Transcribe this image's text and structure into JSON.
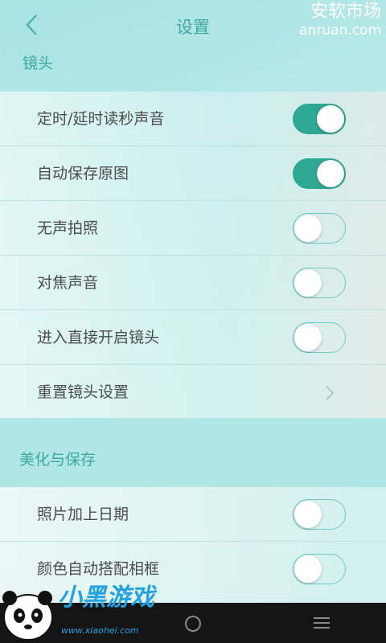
{
  "header": {
    "title": "设置"
  },
  "watermark": {
    "cn": "安软市场",
    "en": "anruan.com"
  },
  "sections": [
    {
      "title": "镜头",
      "rows": [
        {
          "label": "定时/延时读秒声音",
          "toggle": true
        },
        {
          "label": "自动保存原图",
          "toggle": true
        },
        {
          "label": "无声拍照",
          "toggle": false
        },
        {
          "label": "对焦声音",
          "toggle": false
        },
        {
          "label": "进入直接开启镜头",
          "toggle": false
        },
        {
          "label": "重置镜头设置",
          "chevron": true
        }
      ]
    },
    {
      "title": "美化与保存",
      "rows": [
        {
          "label": "照片加上日期",
          "toggle": false
        },
        {
          "label": "颜色自动搭配相框",
          "toggle": false
        }
      ]
    }
  ],
  "logo": {
    "text": "小黑游戏",
    "url_text": "www.xiaohei.com"
  },
  "colors": {
    "accent": "#2ea893",
    "title": "#3fa9a4",
    "section": "#3aa9a1"
  }
}
